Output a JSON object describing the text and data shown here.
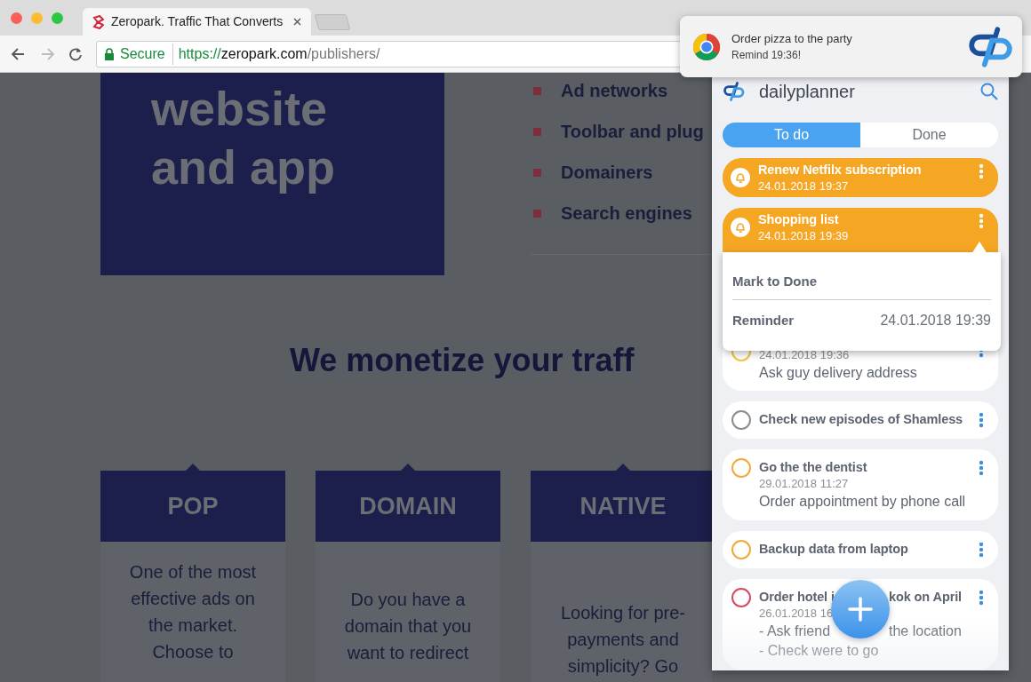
{
  "browser": {
    "tabs": [
      {
        "title": "Zeropark. Traffic That Converts",
        "selected": true
      }
    ],
    "secure_label": "Secure",
    "url": {
      "scheme": "https://",
      "host": "zeropark.com",
      "path": "/publishers/"
    }
  },
  "web_page": {
    "hero_lines": [
      "website",
      "and app"
    ],
    "bullets": [
      "Ad networks",
      "Toolbar and plug",
      "Domainers",
      "Search engines"
    ],
    "heading": "We monetize your traff",
    "cards": [
      {
        "title": "POP",
        "lines": [
          "One of the most",
          "effective ads on",
          "the market.",
          "Choose to"
        ]
      },
      {
        "title": "DOMAIN",
        "lines": [
          "Do you have a",
          "domain that you",
          "want to redirect"
        ]
      },
      {
        "title": "NATIVE",
        "lines": [
          "Looking for pre-",
          "payments and",
          "simplicity? Go"
        ]
      }
    ]
  },
  "notification": {
    "title": "Order pizza to the party",
    "text": "Remind 19:36!"
  },
  "planner": {
    "brand": "daily**planner**",
    "tabs": [
      {
        "label": "To do",
        "selected": true
      },
      {
        "label": "Done",
        "selected": false
      }
    ],
    "tasks": [
      {
        "kind": "reminder",
        "title": [
          "Renew Netfilx subscription"
        ],
        "date": "24.01.2018 19:37",
        "menu_open": false
      },
      {
        "kind": "reminder",
        "title": [
          "Shopping list"
        ],
        "date": "24.01.2018 19:39",
        "menu_open": true
      },
      {
        "kind": "task",
        "color": "#f0c83c",
        "date": "24.01.2018 19:36",
        "note": [
          [
            "Ask guy delivery address"
          ]
        ],
        "menu_open": false
      },
      {
        "kind": "task",
        "color": "#8a8d92",
        "title": [
          "Check new episodes of Shamless"
        ],
        "menu_open": false
      },
      {
        "kind": "task",
        "color": "#f2a93b",
        "title": [
          "Go the the dentist"
        ],
        "date": "29.01.2018 11:27",
        "note": [
          [
            "Order appointment by phone call"
          ]
        ],
        "menu_open": false
      },
      {
        "kind": "task",
        "color": "#f2a93b",
        "title": [
          "Backup data from laptop"
        ],
        "menu_open": false
      },
      {
        "kind": "task",
        "color": "#d9485f",
        "title": [
          "Order hotel i",
          "kok on April"
        ],
        "date": "26.01.2018 16",
        "note": [
          [
            "- Ask friend",
            "the location"
          ],
          [
            "- Check were to go"
          ]
        ],
        "menu_open": false
      }
    ],
    "menu": [
      {
        "kind": "action",
        "label": "Mark to Done"
      },
      {
        "kind": "value",
        "label": "Reminder",
        "value": "24.01.2018 19:39"
      }
    ]
  }
}
